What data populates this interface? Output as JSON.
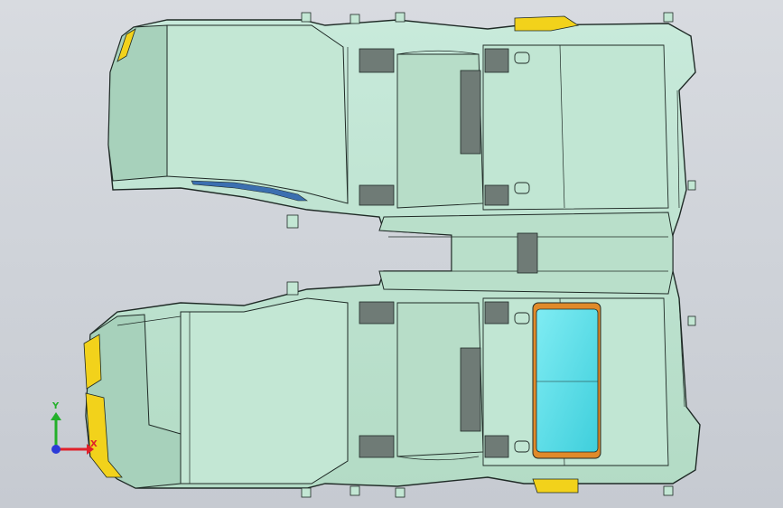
{
  "viewport": {
    "background_top": "#d8dbe0",
    "background_bottom": "#c6cad1"
  },
  "model": {
    "panel_color": "#bfe3cf",
    "panel_shade": "#a9cfba",
    "edge_color": "#1f2a26",
    "accent_yellow": "#f2d21b",
    "highlight_cyan": "#62e0ea",
    "highlight_orange": "#e08a2a",
    "pocket_color": "#6f7b76"
  },
  "triad": {
    "x_label": "X",
    "y_label": "Y",
    "x_color": "#e0202a",
    "y_color": "#23b02a",
    "z_color": "#2b3bd8"
  }
}
